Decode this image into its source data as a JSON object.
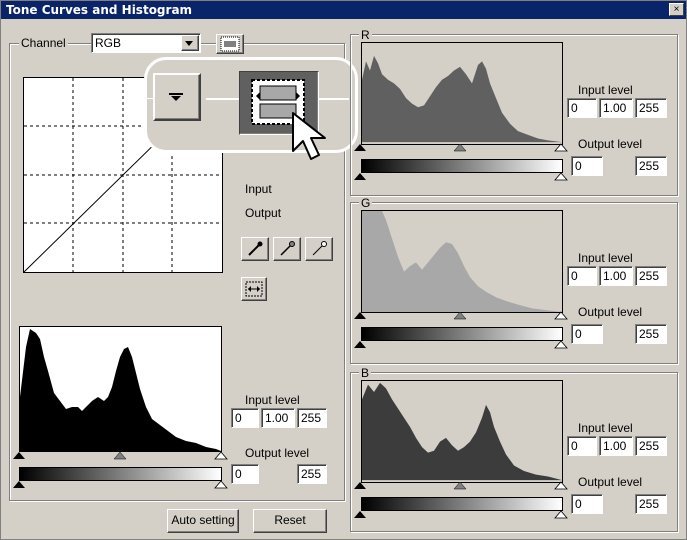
{
  "window": {
    "title": "Tone Curves and Histogram",
    "close_glyph": "×"
  },
  "left": {
    "channel_label": "Channel",
    "channel_value": "RGB",
    "curve_labels": {
      "input": "Input",
      "output": "Output"
    },
    "input_level_label": "Input level",
    "input_values": [
      "0",
      "1.00",
      "255"
    ],
    "output_level_label": "Output level",
    "output_values": [
      "0",
      "255"
    ],
    "auto_setting": "Auto setting",
    "reset": "Reset"
  },
  "channels": [
    {
      "name": "R",
      "input_level_label": "Input level",
      "input_values": [
        "0",
        "1.00",
        "255"
      ],
      "output_level_label": "Output level",
      "output_values": [
        "0",
        "255"
      ]
    },
    {
      "name": "G",
      "input_level_label": "Input level",
      "input_values": [
        "0",
        "1.00",
        "255"
      ],
      "output_level_label": "Output level",
      "output_values": [
        "0",
        "255"
      ]
    },
    {
      "name": "B",
      "input_level_label": "Input level",
      "input_values": [
        "0",
        "1.00",
        "255"
      ],
      "output_level_label": "Output level",
      "output_values": [
        "0",
        "255"
      ]
    }
  ],
  "icons": {
    "eyedroppers": [
      "black-point-dropper-icon",
      "gray-point-dropper-icon",
      "white-point-dropper-icon"
    ],
    "histogram_toggle": "histogram-display-icon",
    "pointer": "mouse-pointer-icon"
  },
  "colors": {
    "red_hist": "#606060",
    "green_hist": "#a8a8a8",
    "blue_hist": "#3c3c3c",
    "title_bar": "#0a246a"
  }
}
